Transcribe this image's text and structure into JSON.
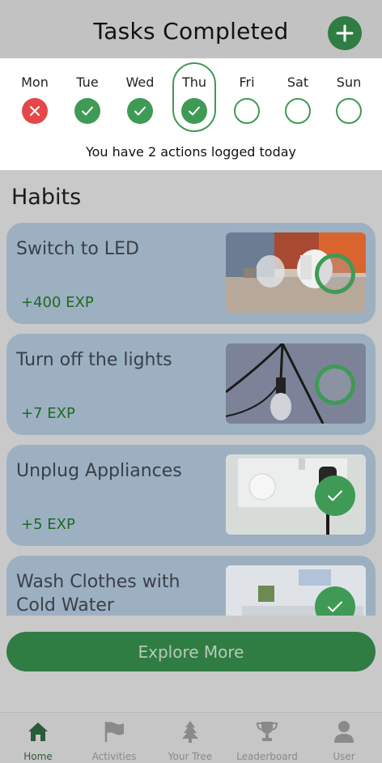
{
  "header": {
    "title": "Tasks Completed",
    "add_icon": "plus-icon"
  },
  "week": {
    "days": [
      {
        "label": "Mon",
        "status": "missed"
      },
      {
        "label": "Tue",
        "status": "done"
      },
      {
        "label": "Wed",
        "status": "done"
      },
      {
        "label": "Thu",
        "status": "done",
        "today": true
      },
      {
        "label": "Fri",
        "status": "empty"
      },
      {
        "label": "Sat",
        "status": "empty"
      },
      {
        "label": "Sun",
        "status": "empty"
      }
    ],
    "summary": "You have 2 actions logged today"
  },
  "habits": {
    "title": "Habits",
    "items": [
      {
        "name": "Switch to LED",
        "exp": "+400 EXP",
        "completed": false,
        "image": "led-bulbs-image"
      },
      {
        "name": "Turn off the lights",
        "exp": "+7 EXP",
        "completed": false,
        "image": "hanging-bulb-image"
      },
      {
        "name": "Unplug Appliances",
        "exp": "+5 EXP",
        "completed": true,
        "image": "wall-socket-image"
      },
      {
        "name": "Wash Clothes with Cold Water",
        "exp": "",
        "completed": true,
        "image": "laundry-room-image"
      }
    ]
  },
  "explore": {
    "label": "Explore More"
  },
  "nav": {
    "items": [
      {
        "label": "Home",
        "icon": "home-icon",
        "active": true
      },
      {
        "label": "Activities",
        "icon": "flag-icon",
        "active": false
      },
      {
        "label": "Your Tree",
        "icon": "tree-icon",
        "active": false
      },
      {
        "label": "Leaderboard",
        "icon": "trophy-icon",
        "active": false
      },
      {
        "label": "User",
        "icon": "user-icon",
        "active": false
      }
    ]
  },
  "colors": {
    "primary": "#2f7d43",
    "check": "#3f9a55",
    "missed": "#e44848",
    "habit_card": "#9cb0c2",
    "exp_text": "#1e6a1e"
  }
}
